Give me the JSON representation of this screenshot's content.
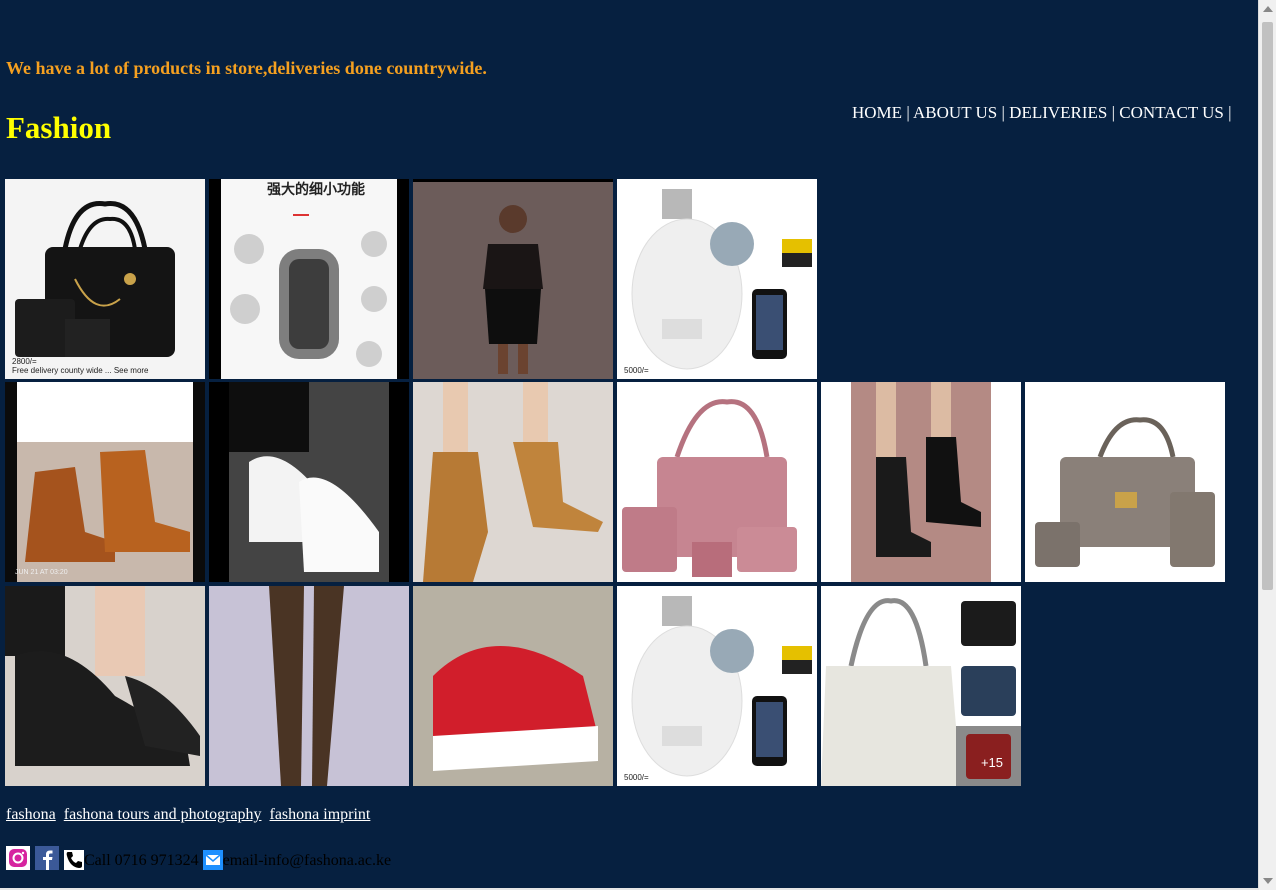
{
  "header": {
    "tagline": "We have a lot of products in store,deliveries done countrywide.",
    "brand": "Fashion"
  },
  "nav": {
    "items": [
      "HOME",
      "ABOUT US",
      "DELIVERIES",
      "CONTACT US"
    ],
    "separator": "|"
  },
  "gallery": {
    "tiles": [
      {
        "caption": "2800/=\nFree delivery county wide ... See more"
      },
      {
        "caption": "强大的细小功能"
      },
      {
        "caption": ""
      },
      {
        "caption": "5000/="
      },
      {
        "caption": "JUN 21 AT 03:20"
      },
      {
        "caption": ""
      },
      {
        "caption": ""
      },
      {
        "caption": ""
      },
      {
        "caption": ""
      },
      {
        "caption": ""
      },
      {
        "caption": ""
      },
      {
        "caption": ""
      },
      {
        "caption": ""
      },
      {
        "caption": "5000/="
      },
      {
        "caption": "+15"
      }
    ]
  },
  "footer": {
    "links": [
      "fashona",
      "fashona tours and photography",
      "fashona imprint"
    ],
    "phone_text": "Call 0716 971324",
    "email_text": "email-info@fashona.ac.ke",
    "icons": [
      "instagram-icon",
      "facebook-icon",
      "phone-icon",
      "email-icon"
    ]
  },
  "colors": {
    "background": "#062040",
    "tagline": "#f5a020",
    "brand": "#ffff00"
  }
}
